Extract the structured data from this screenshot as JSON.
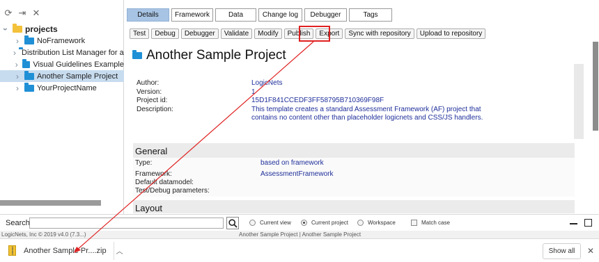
{
  "left_toolbar": {
    "icons": [
      "refresh-icon",
      "import-icon",
      "close-icon"
    ]
  },
  "tree": {
    "root": {
      "label": "projects"
    },
    "items": [
      {
        "label": "NoFramework",
        "selected": false
      },
      {
        "label": "Distribution List Manager for ap",
        "selected": false
      },
      {
        "label": "Visual Guidelines Example",
        "selected": false
      },
      {
        "label": "Another Sample Project",
        "selected": true
      },
      {
        "label": "YourProjectName",
        "selected": false
      }
    ]
  },
  "tabs": [
    {
      "label": "Details",
      "active": true
    },
    {
      "label": "Framework",
      "active": false
    },
    {
      "label": "Data",
      "active": false
    },
    {
      "label": "Change log",
      "active": false
    },
    {
      "label": "Debugger",
      "active": false
    },
    {
      "label": "Tags",
      "active": false
    }
  ],
  "actions": [
    "Test",
    "Debug",
    "Debugger",
    "Validate",
    "Modify",
    "Publish",
    "Export",
    "Sync with repository",
    "Upload to repository"
  ],
  "project": {
    "title": "Another Sample Project",
    "info": [
      {
        "label": "Author:",
        "value": "LogicNets"
      },
      {
        "label": "Version:",
        "value": "1"
      },
      {
        "label": "Project id:",
        "value": "15D1F841CCEDF3FF58795B710369F98F"
      },
      {
        "label": "Description:",
        "value": "This template creates a standard Assessment Framework (AF) project that contains no content other than placeholder logicnets and CSS/JS handlers."
      }
    ]
  },
  "general": {
    "title": "General",
    "rows": [
      {
        "label": "Type:",
        "value": "based on framework"
      },
      {
        "label": "Framework:",
        "value": "AssessmentFramework"
      },
      {
        "label": "Default datamodel:",
        "value": ""
      },
      {
        "label": "Test/Debug parameters:",
        "value": ""
      }
    ]
  },
  "layout_section": {
    "title": "Layout"
  },
  "search": {
    "label": "Search",
    "value": "",
    "scopes": [
      {
        "label": "Current view",
        "selected": false
      },
      {
        "label": "Current project",
        "selected": true
      },
      {
        "label": "Workspace",
        "selected": false
      }
    ],
    "match_case_label": "Match case"
  },
  "status": {
    "left": "LogicNets, Inc © 2019 v4.0 (7.3...)",
    "center": "Another Sample Project | Another Sample Project"
  },
  "download": {
    "file_name": "Another Sample Pr....zip",
    "show_all": "Show all"
  },
  "colors": {
    "active_tab": "#a8c4e4",
    "selected_row": "#c8dcef",
    "value_text": "#1e2f9a",
    "annotation": "#e02020"
  }
}
